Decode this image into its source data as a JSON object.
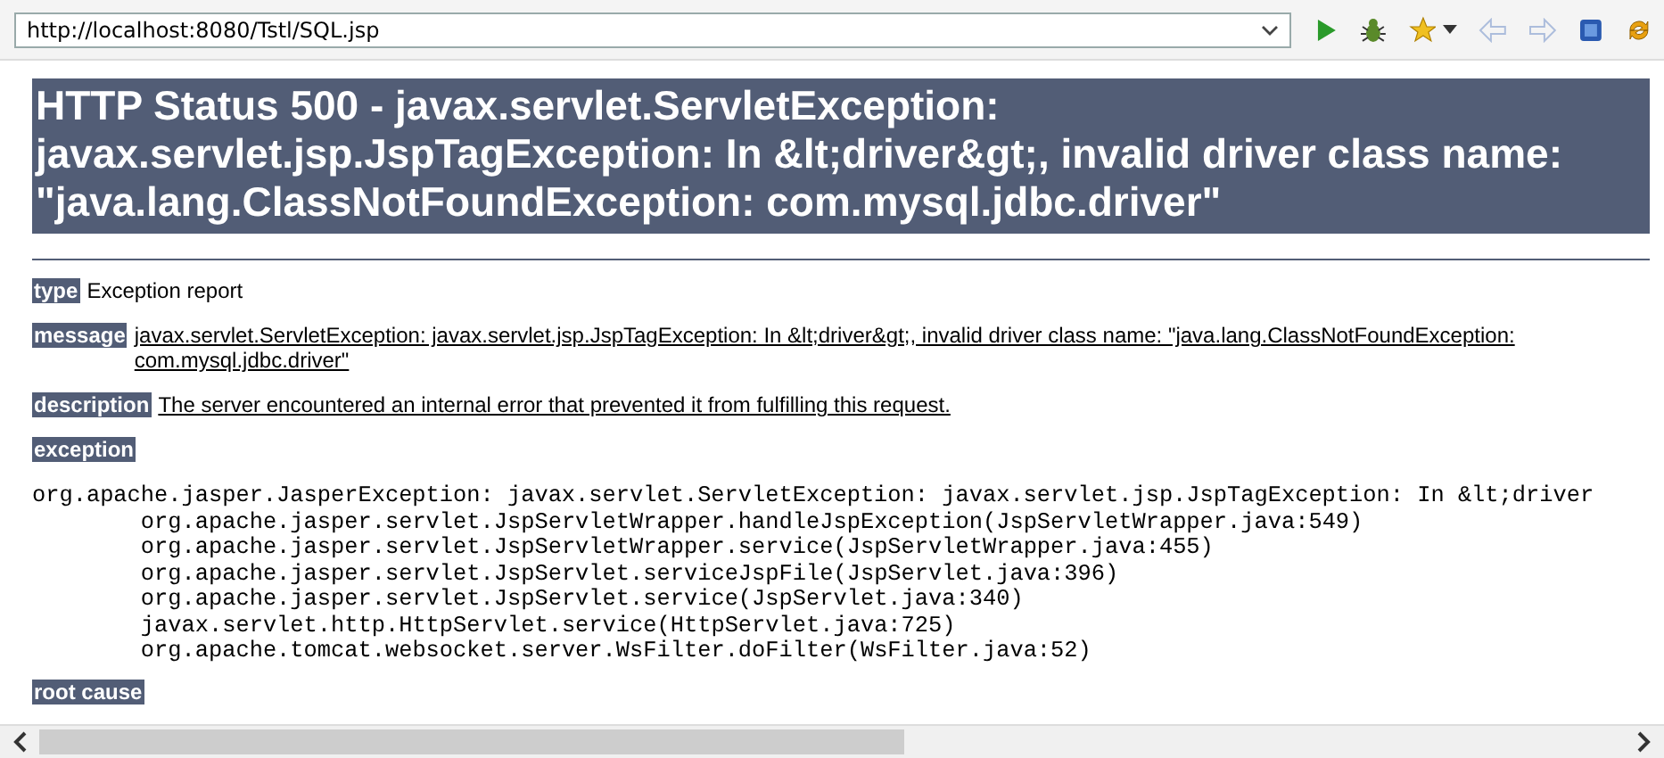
{
  "toolbar": {
    "url": "http://localhost:8080/Tstl/SQL.jsp",
    "back_disabled": true,
    "forward_disabled": true
  },
  "heading": "HTTP Status 500 - javax.servlet.ServletException: javax.servlet.jsp.JspTagException: In &lt;driver&gt;, invalid driver class name: \"java.lang.ClassNotFoundException: com.mysql.jdbc.driver\"",
  "fields": [
    {
      "label": "type",
      "text": "Exception report",
      "underlined": false
    },
    {
      "label": "message",
      "text": "javax.servlet.ServletException: javax.servlet.jsp.JspTagException: In &lt;driver&gt;, invalid driver class name: \"java.lang.ClassNotFoundException: com.mysql.jdbc.driver\"",
      "underlined": true
    },
    {
      "label": "description",
      "text": "The server encountered an internal error that prevented it from fulfilling this request.",
      "underlined": true
    }
  ],
  "exception_label": "exception",
  "trace": [
    "org.apache.jasper.JasperException: javax.servlet.ServletException: javax.servlet.jsp.JspTagException: In &lt;driver",
    "\torg.apache.jasper.servlet.JspServletWrapper.handleJspException(JspServletWrapper.java:549)",
    "\torg.apache.jasper.servlet.JspServletWrapper.service(JspServletWrapper.java:455)",
    "\torg.apache.jasper.servlet.JspServlet.serviceJspFile(JspServlet.java:396)",
    "\torg.apache.jasper.servlet.JspServlet.service(JspServlet.java:340)",
    "\tjavax.servlet.http.HttpServlet.service(HttpServlet.java:725)",
    "\torg.apache.tomcat.websocket.server.WsFilter.doFilter(WsFilter.java:52)"
  ],
  "root_cause_label": "root cause"
}
